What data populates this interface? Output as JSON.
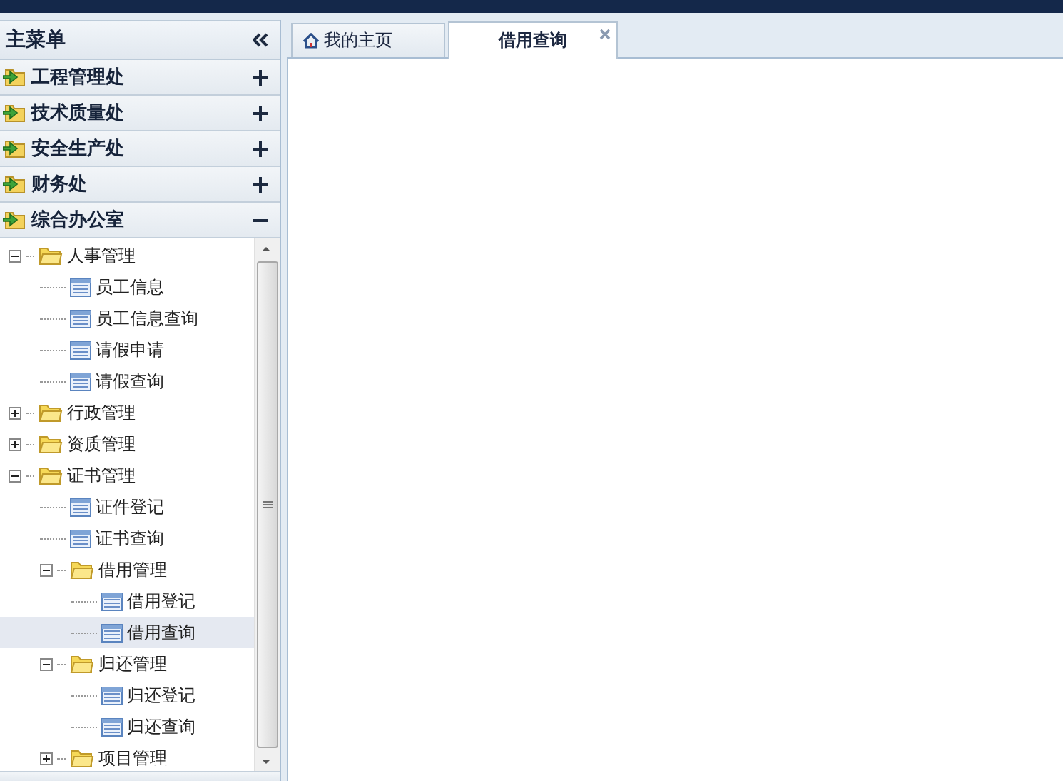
{
  "sidebar": {
    "title": "主菜单",
    "sections": [
      {
        "label": "工程管理处",
        "expanded": false
      },
      {
        "label": "技术质量处",
        "expanded": false
      },
      {
        "label": "安全生产处",
        "expanded": false
      },
      {
        "label": "财务处",
        "expanded": false
      },
      {
        "label": "综合办公室",
        "expanded": true
      }
    ],
    "tree": [
      {
        "label": "人事管理",
        "kind": "folder",
        "expanded": true,
        "children": [
          {
            "label": "员工信息",
            "kind": "page",
            "selected": false
          },
          {
            "label": "员工信息查询",
            "kind": "page",
            "selected": false
          },
          {
            "label": "请假申请",
            "kind": "page",
            "selected": false
          },
          {
            "label": "请假查询",
            "kind": "page",
            "selected": false
          }
        ]
      },
      {
        "label": "行政管理",
        "kind": "folder",
        "expanded": false
      },
      {
        "label": "资质管理",
        "kind": "folder",
        "expanded": false
      },
      {
        "label": "证书管理",
        "kind": "folder",
        "expanded": true,
        "children": [
          {
            "label": "证件登记",
            "kind": "page",
            "selected": false
          },
          {
            "label": "证书查询",
            "kind": "page",
            "selected": false
          },
          {
            "label": "借用管理",
            "kind": "folder",
            "expanded": true,
            "children": [
              {
                "label": "借用登记",
                "kind": "page",
                "selected": false
              },
              {
                "label": "借用查询",
                "kind": "page",
                "selected": true
              }
            ]
          },
          {
            "label": "归还管理",
            "kind": "folder",
            "expanded": true,
            "children": [
              {
                "label": "归还登记",
                "kind": "page",
                "selected": false
              },
              {
                "label": "归还查询",
                "kind": "page",
                "selected": false
              }
            ]
          },
          {
            "label": "项目管理",
            "kind": "folder",
            "expanded": false
          }
        ]
      }
    ]
  },
  "tabs": [
    {
      "label": "我的主页",
      "selected": false,
      "kind": "home"
    },
    {
      "label": "借用查询",
      "selected": true,
      "kind": "closable"
    }
  ]
}
